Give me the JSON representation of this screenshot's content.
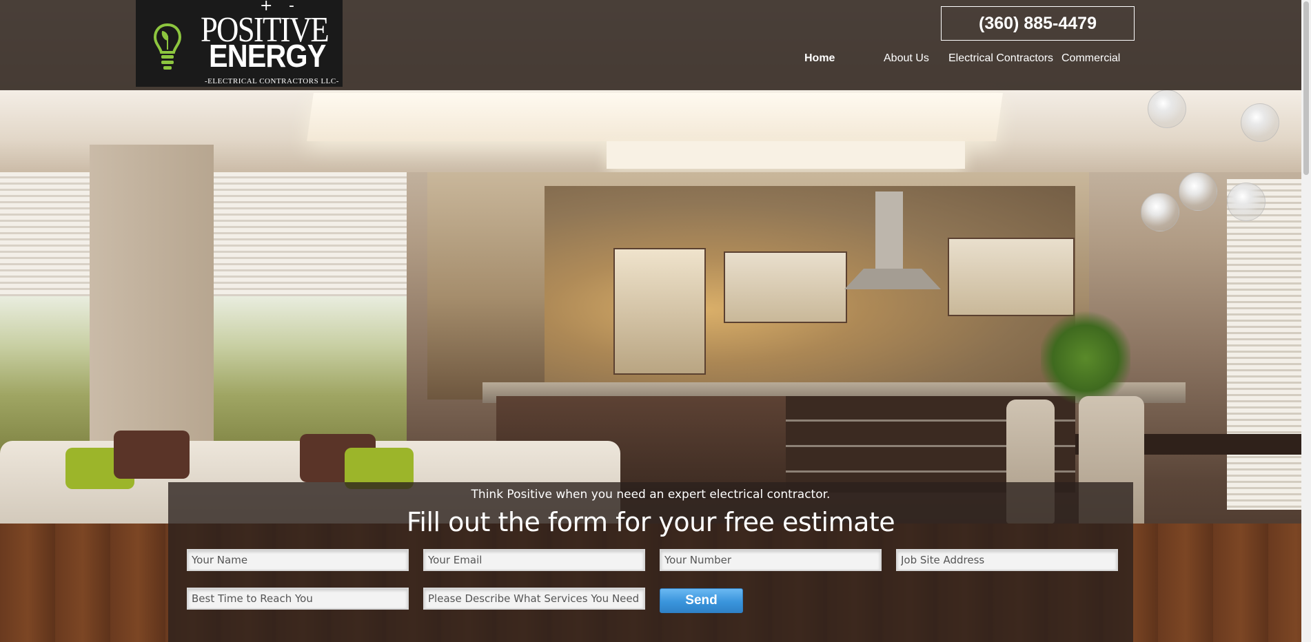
{
  "header": {
    "logo": {
      "plus_sign": "+",
      "minus_sign": "-",
      "line1": "POSITIVE",
      "line2": "ENERGY",
      "tagline": "-ELECTRICAL CONTRACTORS LLC-"
    },
    "phone": "(360) 885-4479",
    "nav": [
      {
        "label": "Home",
        "active": true
      },
      {
        "label": "About Us",
        "active": false
      },
      {
        "label": "Electrical Contractors",
        "active": false
      },
      {
        "label": "Commercial",
        "active": false
      }
    ]
  },
  "estimate_form": {
    "tagline": "Think Positive when you need an expert electrical contractor.",
    "title": "Fill out the form for your free estimate",
    "fields": {
      "name": {
        "placeholder": "Your Name"
      },
      "email": {
        "placeholder": "Your Email"
      },
      "number": {
        "placeholder": "Your Number"
      },
      "address": {
        "placeholder": "Job Site Address"
      },
      "best_time": {
        "placeholder": "Best Time to Reach You"
      },
      "services": {
        "placeholder": "Please Describe What Services You Need"
      }
    },
    "send_label": "Send"
  },
  "colors": {
    "header_bg": "#2e241e",
    "logo_bg": "#1a1a1a",
    "logo_accent": "#8dc63f",
    "send_button": "#3a95dc"
  },
  "icons": {
    "logo_bulb": "lightbulb-icon"
  }
}
